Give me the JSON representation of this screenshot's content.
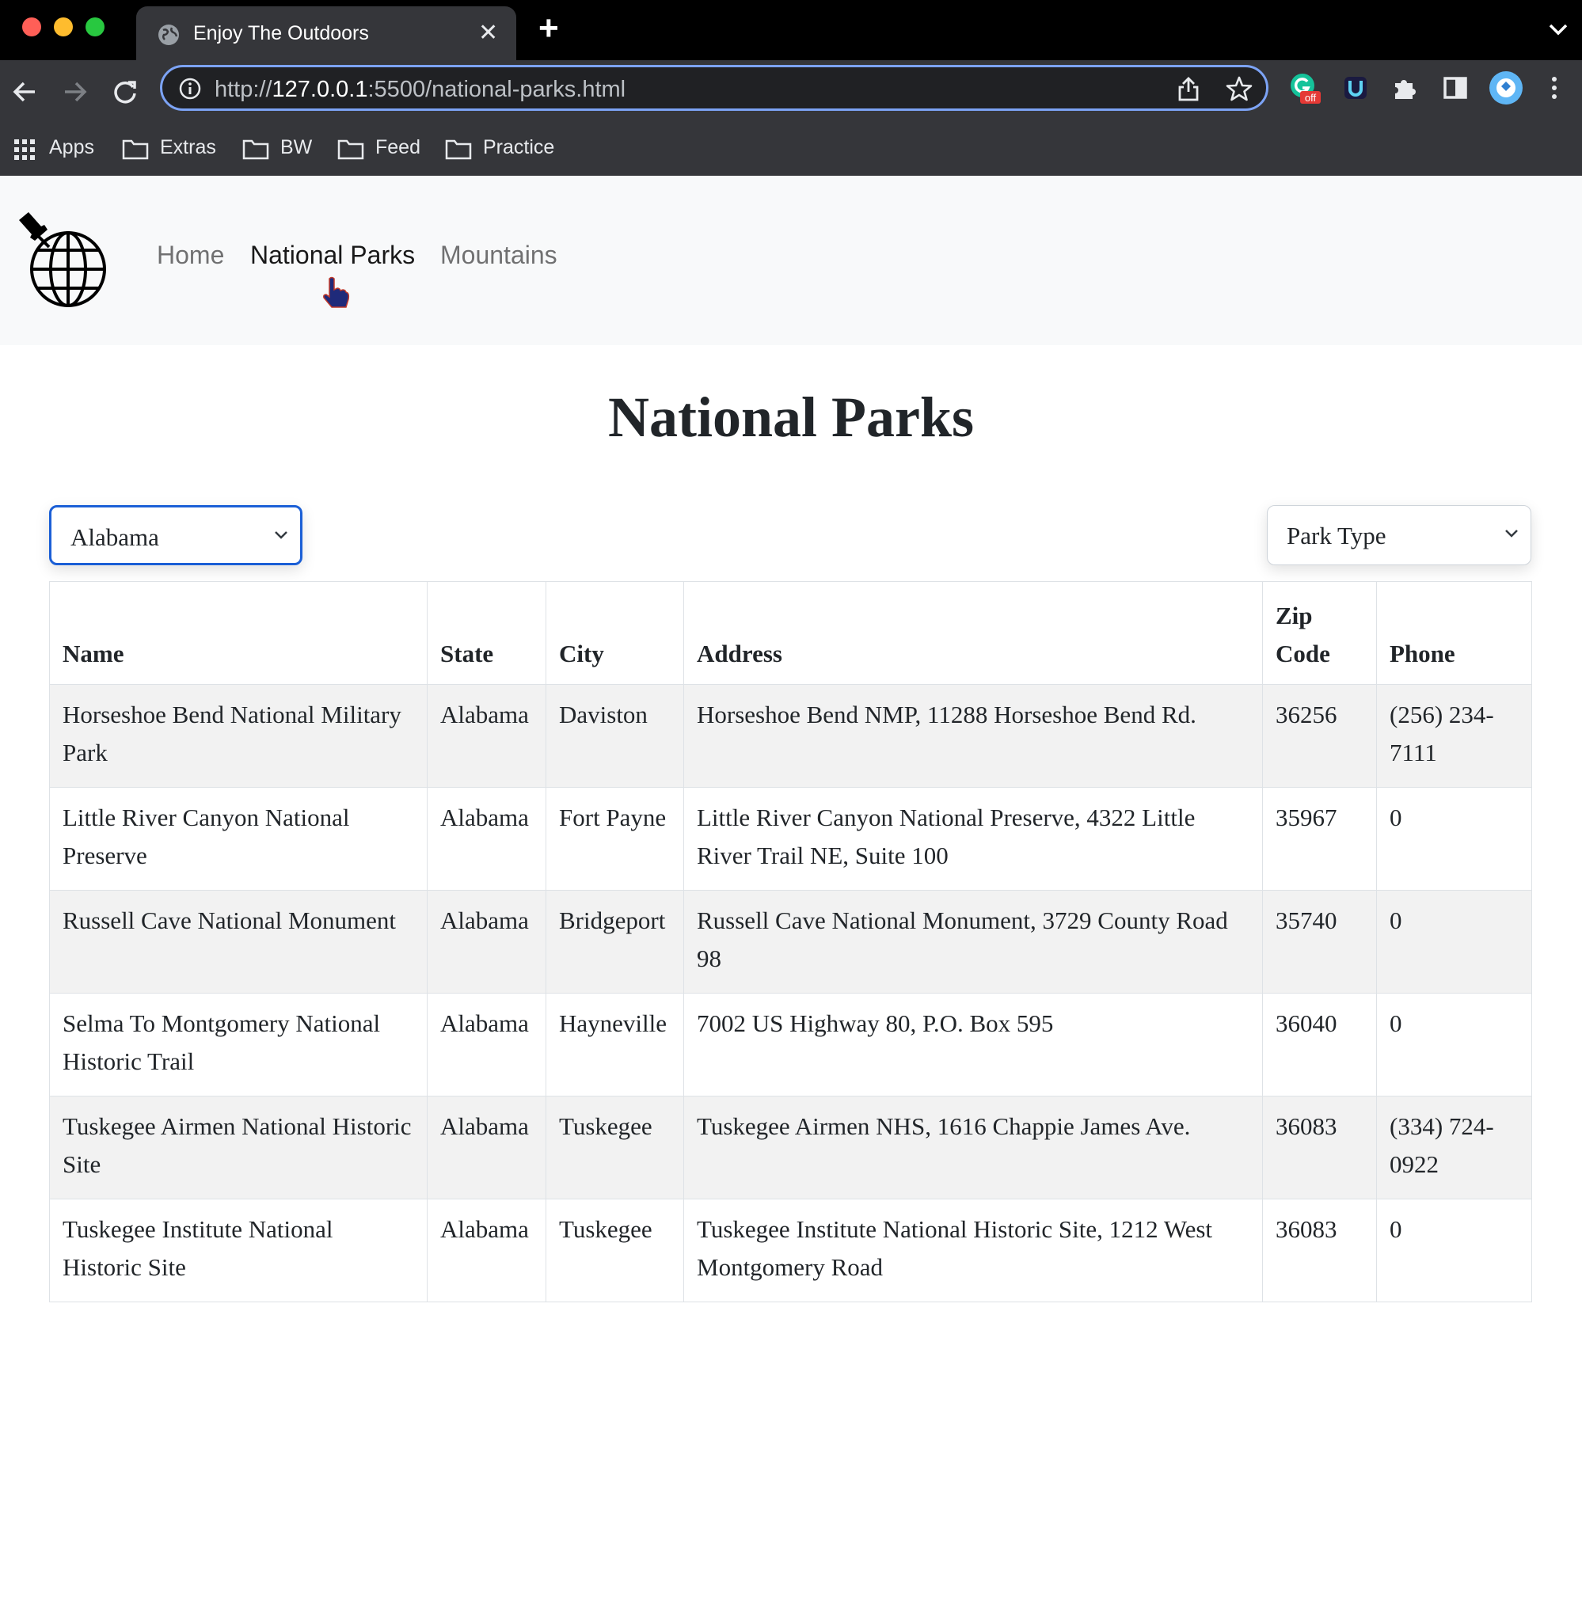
{
  "browser": {
    "tab_title": "Enjoy The Outdoors",
    "url_scheme": "http://",
    "url_host": "127.0.0.1",
    "url_path": ":5500/national-parks.html",
    "bookmarks": [
      {
        "label": "Apps"
      },
      {
        "label": "Extras"
      },
      {
        "label": "BW"
      },
      {
        "label": "Feed"
      },
      {
        "label": "Practice"
      }
    ],
    "extension_badge": "off"
  },
  "navbar": {
    "links": [
      {
        "label": "Home"
      },
      {
        "label": "National Parks"
      },
      {
        "label": "Mountains"
      }
    ]
  },
  "main": {
    "title": "National Parks",
    "state_select": {
      "value": "Alabama"
    },
    "type_select": {
      "value": "Park Type"
    }
  },
  "table": {
    "headers": [
      "Name",
      "State",
      "City",
      "Address",
      "Zip Code",
      "Phone"
    ],
    "rows": [
      [
        "Horseshoe Bend National Military Park",
        "Alabama",
        "Daviston",
        "Horseshoe Bend NMP, 11288 Horseshoe Bend Rd.",
        "36256",
        "(256) 234-7111"
      ],
      [
        "Little River Canyon National Preserve",
        "Alabama",
        "Fort Payne",
        "Little River Canyon National Preserve, 4322 Little River Trail NE, Suite 100",
        "35967",
        "0"
      ],
      [
        "Russell Cave National Monument",
        "Alabama",
        "Bridgeport",
        "Russell Cave National Monument, 3729 County Road 98",
        "35740",
        "0"
      ],
      [
        "Selma To Montgomery National Historic Trail",
        "Alabama",
        "Hayneville",
        "7002 US Highway 80, P.O. Box 595",
        "36040",
        "0"
      ],
      [
        "Tuskegee Airmen National Historic Site",
        "Alabama",
        "Tuskegee",
        "Tuskegee Airmen NHS, 1616 Chappie James Ave.",
        "36083",
        "(334) 724-0922"
      ],
      [
        "Tuskegee Institute National Historic Site",
        "Alabama",
        "Tuskegee",
        "Tuskegee Institute National Historic Site, 1212 West Montgomery Road",
        "36083",
        "0"
      ]
    ]
  },
  "colors": {
    "tabstrip": "#000000",
    "toolbar": "#35363a",
    "omnibox_focus": "#7ca3f5",
    "navbar_bg": "#f8f9fa",
    "select_focus": "#1b5fd6",
    "row_stripe": "#f2f2f2"
  }
}
